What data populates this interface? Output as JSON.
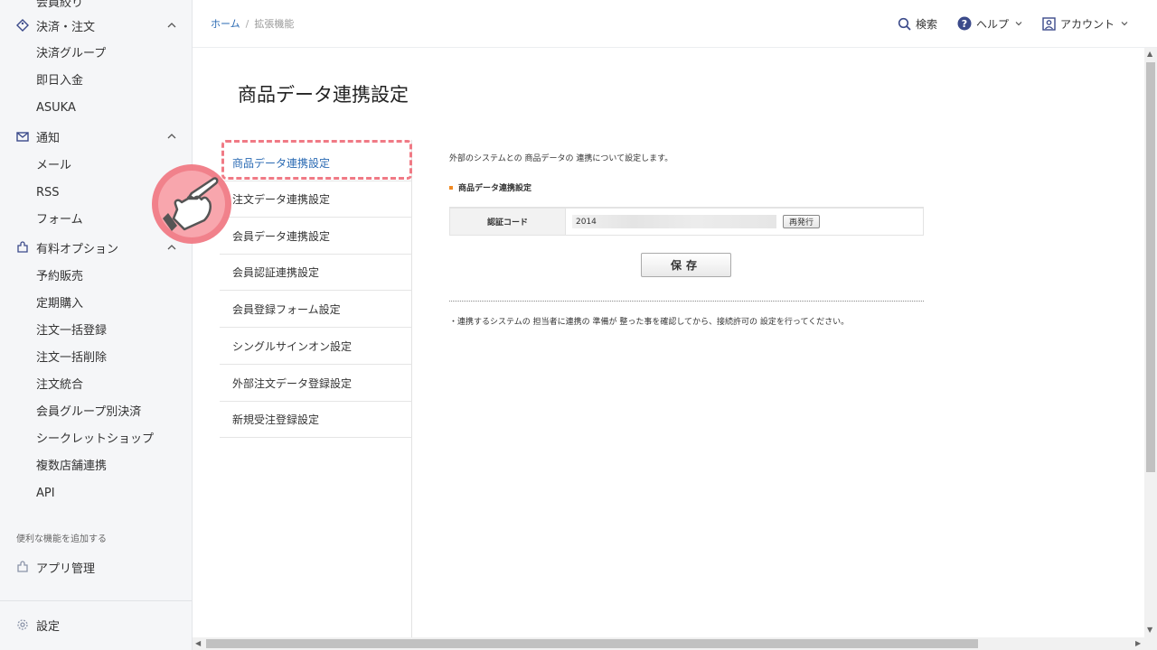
{
  "sidebar": {
    "cut_item": "会員絞り",
    "groups": [
      {
        "label": "決済・注文",
        "icon": "tag-icon",
        "items": [
          "決済グループ",
          "即日入金",
          "ASUKA"
        ]
      },
      {
        "label": "通知",
        "icon": "mail-icon",
        "items": [
          "メール",
          "RSS",
          "フォーム"
        ]
      },
      {
        "label": "有料オプション",
        "icon": "puzzle-icon",
        "items": [
          "予約販売",
          "定期購入",
          "注文一括登録",
          "注文一括削除",
          "注文統合",
          "会員グループ別決済",
          "シークレットショップ",
          "複数店舗連携",
          "API"
        ]
      }
    ],
    "caption": "便利な機能を追加する",
    "app_manage": "アプリ管理",
    "settings": "設定"
  },
  "topbar": {
    "breadcrumb_home": "ホーム",
    "breadcrumb_sep": "/",
    "breadcrumb_current": "拡張機能",
    "search": "検索",
    "help": "ヘルプ",
    "account": "アカウント"
  },
  "main": {
    "title": "商品データ連携設定",
    "submenu": [
      "商品データ連携設定",
      "注文データ連携設定",
      "会員データ連携設定",
      "会員認証連携設定",
      "会員登録フォーム設定",
      "シングルサインオン設定",
      "外部注文データ登録設定",
      "新規受注登録設定"
    ],
    "intro": "外部のシステムとの 商品データの 連携について設定します。",
    "section_title": "商品データ連携設定",
    "auth_code_label": "認証コード",
    "auth_code_value": "2014",
    "reissue_button": "再発行",
    "save_button": "保存",
    "note": "・連携するシステムの 担当者に連携の 準備が 整った事を確認してから、接続許可の 設定を行ってください。"
  },
  "colors": {
    "accent": "#2a6ab3",
    "highlight": "#f07a85",
    "section_marker": "#f08a24"
  }
}
